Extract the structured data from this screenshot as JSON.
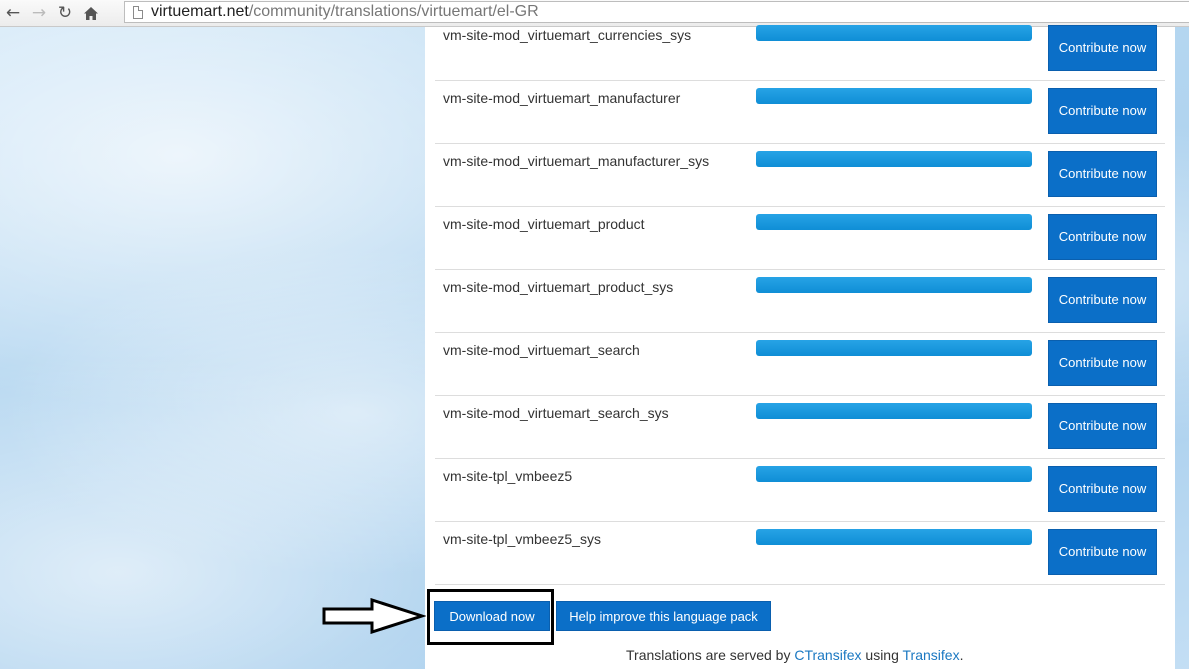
{
  "browser": {
    "back_icon": "back-arrow-icon",
    "forward_icon": "forward-arrow-icon",
    "reload_icon": "reload-icon",
    "home_icon": "home-icon",
    "url_host": "virtuemart.net",
    "url_path": "/community/translations/virtuemart/el-GR"
  },
  "rows": [
    {
      "name": "vm-site-mod_virtuemart_currencies_sys",
      "progress": 1.0,
      "button_label": "Contribute now"
    },
    {
      "name": "vm-site-mod_virtuemart_manufacturer",
      "progress": 1.0,
      "button_label": "Contribute now"
    },
    {
      "name": "vm-site-mod_virtuemart_manufacturer_sys",
      "progress": 1.0,
      "button_label": "Contribute now"
    },
    {
      "name": "vm-site-mod_virtuemart_product",
      "progress": 1.0,
      "button_label": "Contribute now"
    },
    {
      "name": "vm-site-mod_virtuemart_product_sys",
      "progress": 1.0,
      "button_label": "Contribute now"
    },
    {
      "name": "vm-site-mod_virtuemart_search",
      "progress": 1.0,
      "button_label": "Contribute now"
    },
    {
      "name": "vm-site-mod_virtuemart_search_sys",
      "progress": 1.0,
      "button_label": "Contribute now"
    },
    {
      "name": "vm-site-tpl_vmbeez5",
      "progress": 1.0,
      "button_label": "Contribute now"
    },
    {
      "name": "vm-site-tpl_vmbeez5_sys",
      "progress": 1.0,
      "button_label": "Contribute now"
    }
  ],
  "actions": {
    "download_label": "Download now",
    "help_label": "Help improve this language pack"
  },
  "footer": {
    "prefix": "Translations are served by ",
    "link1": "CTransifex",
    "middle": " using ",
    "link2": "Transifex",
    "suffix": "."
  },
  "colors": {
    "button_blue": "#0b6fc8",
    "progress_blue": "#1a98de",
    "link_blue": "#1a78c2"
  }
}
